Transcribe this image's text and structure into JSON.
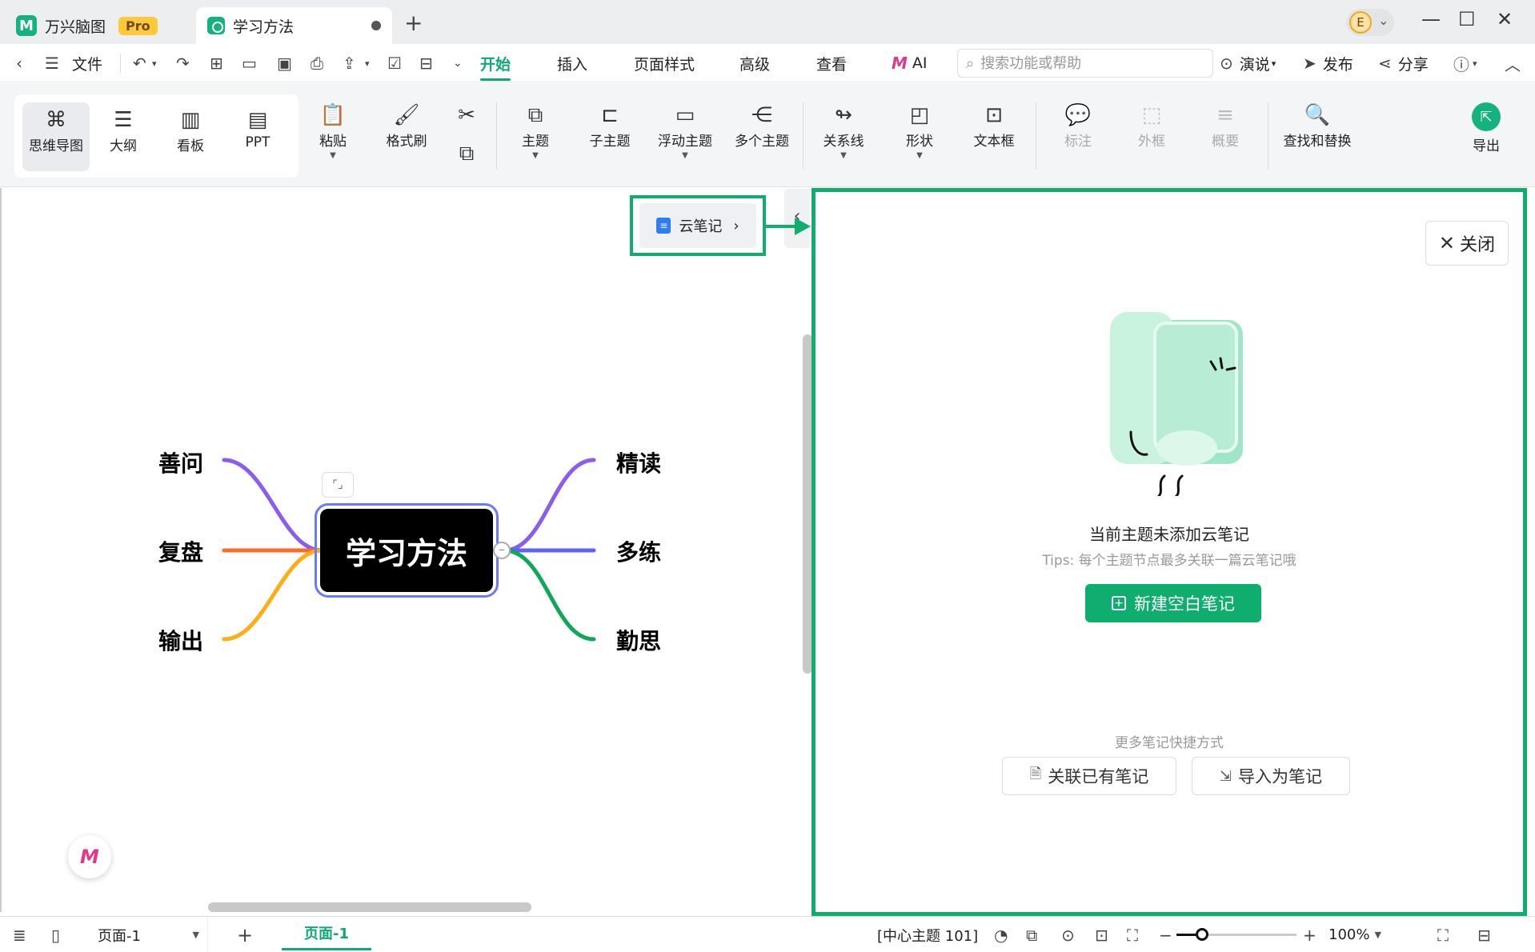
{
  "titlebar": {
    "app_name": "万兴脑图",
    "pro_badge": "Pro",
    "doc_tab": "学习方法",
    "new_tab_icon": "plus-icon",
    "avatar_letter": "E"
  },
  "menubar": {
    "file": "文件",
    "tabs": [
      "开始",
      "插入",
      "页面样式",
      "高级",
      "查看"
    ],
    "active_tab": "开始",
    "ai": "AI",
    "search_placeholder": "搜索功能或帮助",
    "present": "演说",
    "publish": "发布",
    "share": "分享"
  },
  "toolbar": {
    "views": [
      "思维导图",
      "大纲",
      "看板",
      "PPT"
    ],
    "active_view": "思维导图",
    "paste": "粘贴",
    "format_painter": "格式刷",
    "topic": "主题",
    "subtopic": "子主题",
    "floating_topic": "浮动主题",
    "multiple_topics": "多个主题",
    "relationship": "关系线",
    "shape": "形状",
    "textbox": "文本框",
    "callout": "标注",
    "boundary": "外框",
    "summary": "概要",
    "find_replace": "查找和替换",
    "export": "导出"
  },
  "canvas": {
    "cloud_note_button": "云笔记",
    "central_topic": "学习方法",
    "left_topics": [
      "善问",
      "复盘",
      "输出"
    ],
    "right_topics": [
      "精读",
      "多练",
      "勤思"
    ],
    "branch_colors": {
      "善问": "#8a5cf0",
      "复盘": "#ff6a2b",
      "输出": "#ffad14",
      "精读": "#8a5cf0",
      "多练": "#5b64f5",
      "勤思": "#0ea85a"
    }
  },
  "panel": {
    "close": "关闭",
    "empty_title": "当前主题未添加云笔记",
    "empty_tip": "Tips: 每个主题节点最多关联一篇云笔记哦",
    "new_note": "新建空白笔记",
    "more_label": "更多笔记快捷方式",
    "link_existing": "关联已有笔记",
    "import_as_note": "导入为笔记",
    "accent": "#0fae6e"
  },
  "statusbar": {
    "page_select": "页面-1",
    "page_tab": "页面-1",
    "topic_count": "[中心主题 101]",
    "zoom": "100%",
    "zoom_level": 0.21
  }
}
